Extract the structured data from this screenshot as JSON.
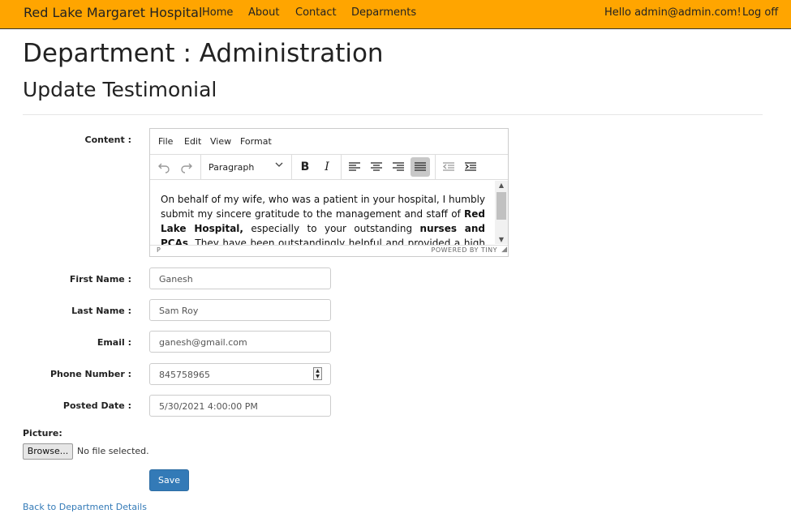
{
  "nav": {
    "brand": "Red Lake Margaret Hospital",
    "links": [
      "Home",
      "About",
      "Contact",
      "Deparments"
    ],
    "greeting": "Hello admin@admin.com!",
    "logoff": "Log off"
  },
  "page": {
    "title": "Department : Administration",
    "subtitle": "Update Testimonial"
  },
  "form": {
    "content_label": "Content :",
    "editor": {
      "menus": [
        "File",
        "Edit",
        "View",
        "Format"
      ],
      "block_format": "Paragraph",
      "content_parts": [
        "On behalf of my wife, who was a patient in your hospital, I humbly submit my sincere gratitude to the management and staff of ",
        "Red Lake Hospital,",
        " especially to your outstanding ",
        "nurses and PCAs",
        ". They have been outstandingly helpful and provided a high quality of"
      ],
      "path": "P",
      "powered_by": "POWERED BY TINY"
    },
    "first_name_label": "First Name :",
    "first_name": "Ganesh",
    "last_name_label": "Last Name :",
    "last_name": "Sam Roy",
    "email_label": "Email :",
    "email": "ganesh@gmail.com",
    "phone_label": "Phone Number :",
    "phone": "845758965",
    "posted_date_label": "Posted Date :",
    "posted_date": "5/30/2021 4:00:00 PM",
    "picture_label": "Picture:",
    "browse_label": "Browse...",
    "file_status": "No file selected.",
    "save_label": "Save"
  },
  "back_link": "Back to Department Details",
  "colors": {
    "navbar": "#ffa500",
    "primary": "#337ab7"
  }
}
